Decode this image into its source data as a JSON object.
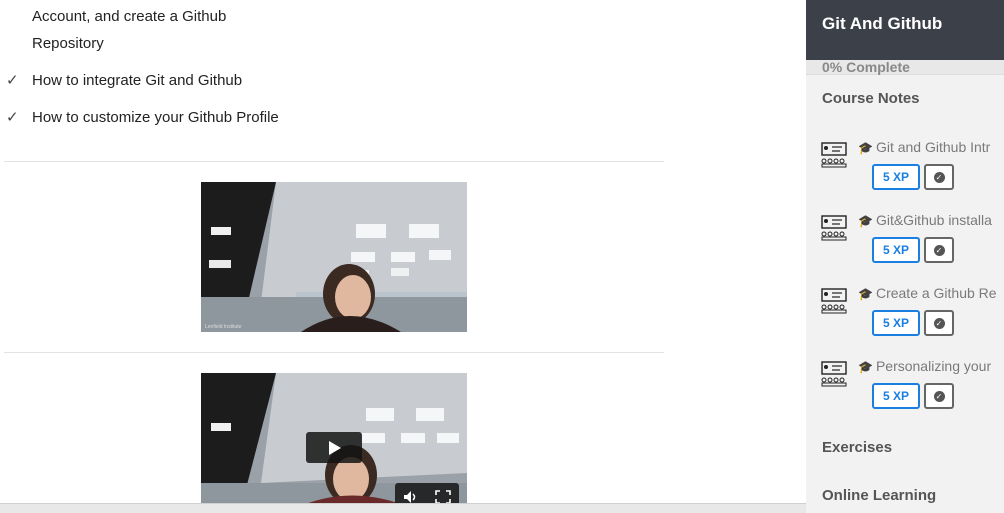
{
  "objectives": {
    "item1_line1": "Account, and create a Github",
    "item1_line2": "Repository",
    "item2": "How to integrate Git and Github",
    "item3": "How to customize your Github Profile",
    "check_glyph": "✓"
  },
  "videos": [
    {
      "caption": "Lenfield Institute",
      "has_play_button": false
    },
    {
      "caption": "",
      "has_play_button": true,
      "play_icon": "play-icon",
      "volume_icon": "volume-icon",
      "fullscreen_icon": "fullscreen-icon"
    }
  ],
  "sidebar": {
    "title": "Git And Github",
    "progress_text": "0% Complete",
    "progress_value": 0,
    "course_notes_label": "Course Notes",
    "lessons": [
      {
        "title": "Git and Github Intr",
        "xp": "5 XP"
      },
      {
        "title": "Git&Github installa",
        "xp": "5 XP"
      },
      {
        "title": "Create a Github Re",
        "xp": "5 XP"
      },
      {
        "title": "Personalizing your",
        "xp": "5 XP"
      }
    ],
    "exercises_label": "Exercises",
    "online_learning_label": "Online Learning"
  },
  "colors": {
    "sidebar_header": "#3c4048",
    "xp_accent": "#1a7fe0",
    "sidebar_bg": "#f2f2f2"
  }
}
